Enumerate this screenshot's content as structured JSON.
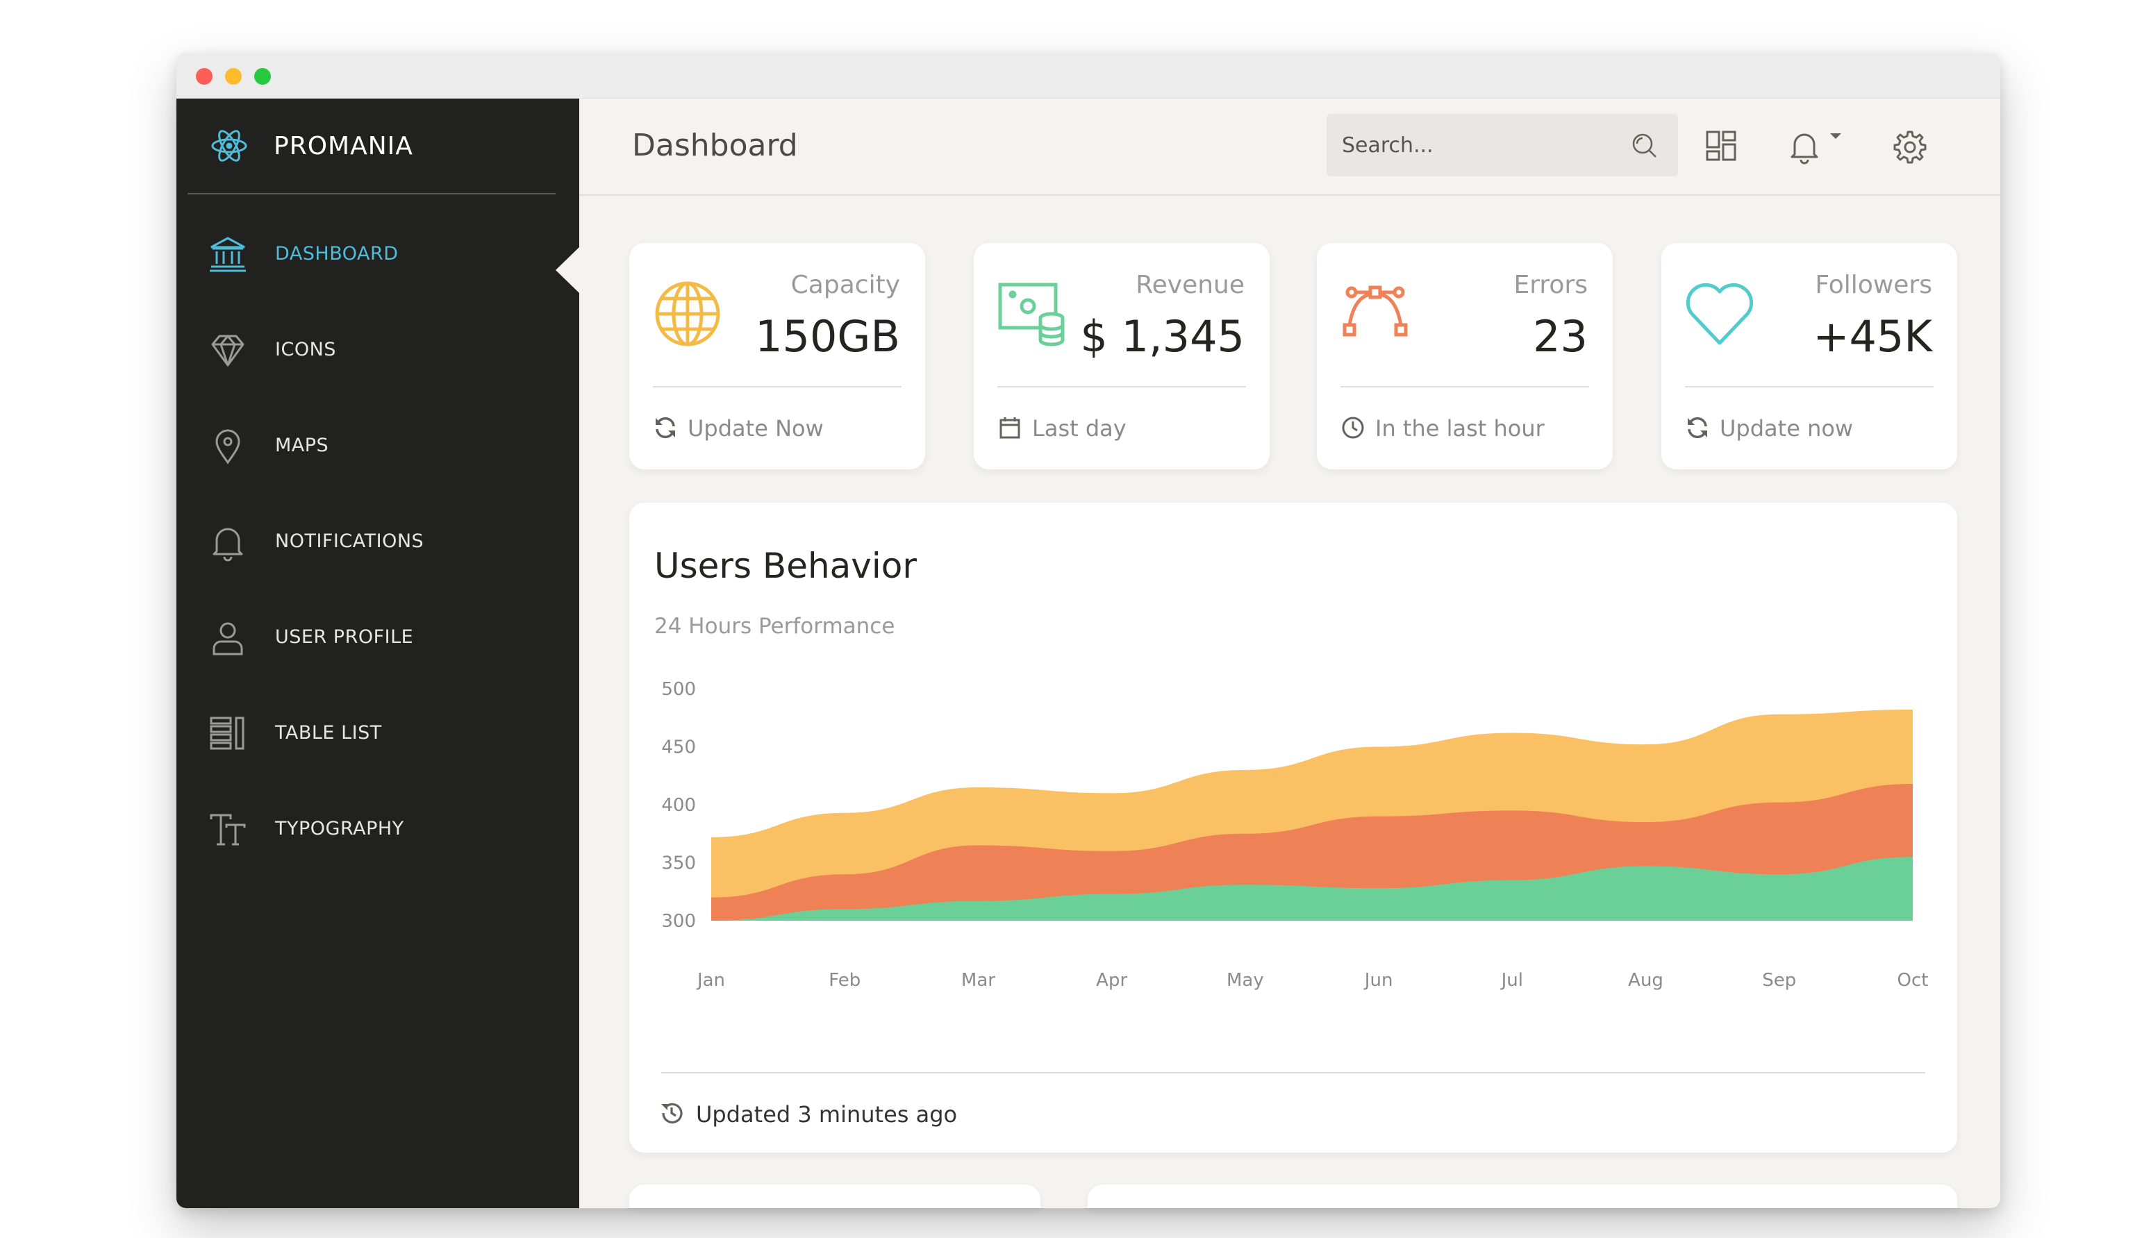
{
  "app": {
    "name": "PROMANIA"
  },
  "colors": {
    "accent": "#51bcda",
    "sidebar_bg": "#212120",
    "page_bg": "#f4f3ef"
  },
  "sidebar": {
    "items": [
      {
        "label": "DASHBOARD",
        "icon": "bank-icon",
        "active": true
      },
      {
        "label": "ICONS",
        "icon": "diamond-icon"
      },
      {
        "label": "MAPS",
        "icon": "map-pin-icon"
      },
      {
        "label": "NOTIFICATIONS",
        "icon": "bell-icon"
      },
      {
        "label": "USER PROFILE",
        "icon": "user-icon"
      },
      {
        "label": "TABLE LIST",
        "icon": "table-list-icon"
      },
      {
        "label": "TYPOGRAPHY",
        "icon": "typography-icon"
      }
    ]
  },
  "header": {
    "title": "Dashboard",
    "search_placeholder": "Search...",
    "icons": [
      "search-icon",
      "grid-icon",
      "bell-icon",
      "caret-down-icon",
      "gear-icon"
    ]
  },
  "stats": [
    {
      "label": "Capacity",
      "value": "150GB",
      "footer": "Update Now",
      "icon": "globe-icon",
      "footer_icon": "refresh-icon",
      "color": "#f3bb45"
    },
    {
      "label": "Revenue",
      "value": "$ 1,345",
      "footer": "Last day",
      "icon": "money-coins-icon",
      "footer_icon": "calendar-icon",
      "color": "#6bd098"
    },
    {
      "label": "Errors",
      "value": "23",
      "footer": "In the last hour",
      "icon": "vector-icon",
      "footer_icon": "clock-icon",
      "color": "#ef8157"
    },
    {
      "label": "Followers",
      "value": "+45K",
      "footer": "Update now",
      "icon": "heart-icon",
      "footer_icon": "refresh-icon",
      "color": "#51cbce"
    }
  ],
  "chart": {
    "title": "Users Behavior",
    "subtitle": "24 Hours Performance",
    "footer": "Updated 3 minutes ago",
    "footer_icon": "history-icon"
  },
  "chart_data": {
    "type": "area",
    "categories": [
      "Jan",
      "Feb",
      "Mar",
      "Apr",
      "May",
      "Jun",
      "Jul",
      "Aug",
      "Sep",
      "Oct"
    ],
    "ylim": [
      300,
      500
    ],
    "yticks": [
      500,
      450,
      400,
      350,
      300
    ],
    "series": [
      {
        "color": "#f9c064",
        "values": [
          372,
          393,
          415,
          410,
          430,
          450,
          462,
          452,
          478,
          482
        ]
      },
      {
        "color": "#ef8157",
        "values": [
          320,
          340,
          365,
          360,
          375,
          390,
          395,
          385,
          402,
          418
        ]
      },
      {
        "color": "#6bd098",
        "values": [
          300,
          310,
          317,
          323,
          331,
          328,
          335,
          347,
          340,
          355
        ]
      }
    ],
    "grid": false,
    "legend": "none"
  }
}
